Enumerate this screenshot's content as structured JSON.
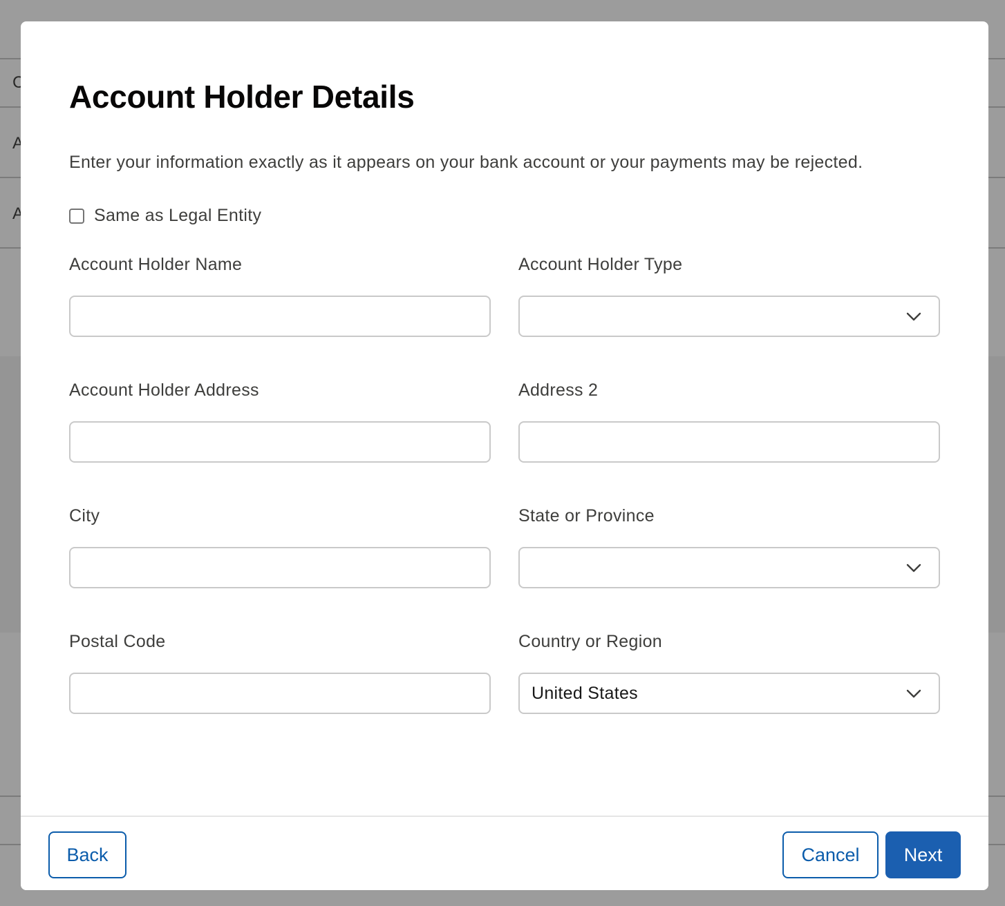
{
  "background": {
    "row_initials": [
      "C",
      "A",
      "A"
    ]
  },
  "modal": {
    "title": "Account Holder Details",
    "description": "Enter your information exactly as it appears on your bank account or your payments may be rejected.",
    "same_as_legal_entity": {
      "label": "Same as Legal Entity",
      "checked": false
    },
    "fields": {
      "account_holder_name": {
        "label": "Account Holder Name",
        "value": ""
      },
      "account_holder_type": {
        "label": "Account Holder Type",
        "value": ""
      },
      "account_holder_address": {
        "label": "Account Holder Address",
        "value": ""
      },
      "address_2": {
        "label": "Address 2",
        "value": ""
      },
      "city": {
        "label": "City",
        "value": ""
      },
      "state_or_province": {
        "label": "State or Province",
        "value": ""
      },
      "postal_code": {
        "label": "Postal Code",
        "value": ""
      },
      "country_or_region": {
        "label": "Country or Region",
        "value": "United States"
      }
    },
    "footer": {
      "back_label": "Back",
      "cancel_label": "Cancel",
      "next_label": "Next"
    }
  },
  "colors": {
    "brand": "#1b5fb0",
    "neutral_border": "#0b5cab",
    "field_border": "#c9c9c9",
    "overlay": "#989898"
  },
  "icons": {
    "select_chevron": "chevron-down-icon"
  }
}
